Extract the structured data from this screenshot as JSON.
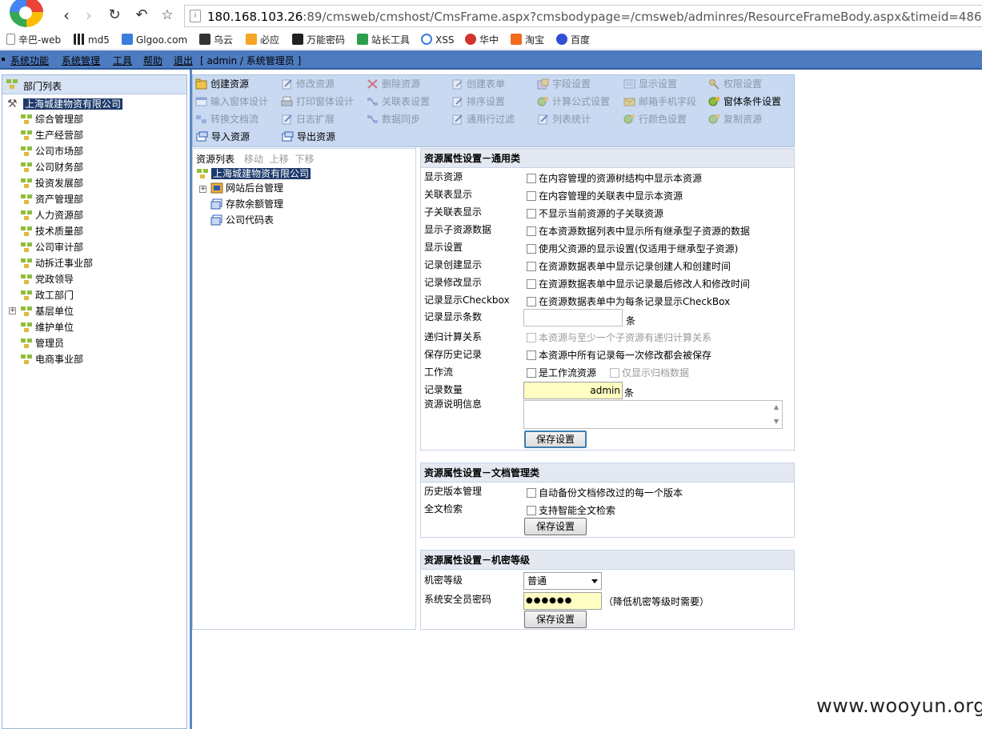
{
  "browser": {
    "url_host": "180.168.103.26",
    "url_path": ":89/cmsweb/cmshost/CmsFrame.aspx?cmsbodypage=/cmsweb/adminres/ResourceFrameBody.aspx&timeid=486686",
    "bookmarks": [
      "辛巴-web",
      "md5",
      "Glgoo.com",
      "乌云",
      "必应",
      "万能密码",
      "站长工具",
      "XSS",
      "华中",
      "淘宝",
      "百度"
    ]
  },
  "menubar": {
    "items": [
      "系统功能",
      "系统管理",
      "工具",
      "帮助",
      "退出"
    ],
    "user": "[ admin / 系统管理员 ]"
  },
  "dept_tree": {
    "header": "部门列表",
    "root": "上海城建物资有限公司",
    "departments": [
      "综合管理部",
      "生产经营部",
      "公司市场部",
      "公司财务部",
      "投资发展部",
      "资产管理部",
      "人力资源部",
      "技术质量部",
      "公司审计部",
      "动拆迁事业部",
      "党政领导",
      "政工部门",
      "基层单位",
      "维护单位",
      "管理员",
      "电商事业部"
    ]
  },
  "toolbar": {
    "row1": [
      {
        "label": "创建资源",
        "enabled": true,
        "icon": "folder-open-icon"
      },
      {
        "label": "修改资源",
        "enabled": false,
        "icon": "edit-icon"
      },
      {
        "label": "删除资源",
        "enabled": false,
        "icon": "delete-icon"
      },
      {
        "label": "创建表单",
        "enabled": false,
        "icon": "form-icon"
      },
      {
        "label": "字段设置",
        "enabled": false,
        "icon": "field-icon"
      },
      {
        "label": "显示设置",
        "enabled": false,
        "icon": "display-icon"
      },
      {
        "label": "权限设置",
        "enabled": false,
        "icon": "key-icon"
      }
    ],
    "row2": [
      {
        "label": "输入窗体设计",
        "enabled": false,
        "icon": "window-icon"
      },
      {
        "label": "打印窗体设计",
        "enabled": false,
        "icon": "printer-icon"
      },
      {
        "label": "关联表设置",
        "enabled": false,
        "icon": "relation-icon"
      },
      {
        "label": "排序设置",
        "enabled": false,
        "icon": "sort-icon"
      },
      {
        "label": "计算公式设置",
        "enabled": false,
        "icon": "formula-icon"
      },
      {
        "label": "邮箱手机字段",
        "enabled": false,
        "icon": "mail-icon"
      },
      {
        "label": "窗体条件设置",
        "enabled": true,
        "icon": "condition-icon"
      }
    ],
    "row3": [
      {
        "label": "转换文档流",
        "enabled": false,
        "icon": "convert-icon"
      },
      {
        "label": "日志扩展",
        "enabled": false,
        "icon": "log-icon"
      },
      {
        "label": "数据同步",
        "enabled": false,
        "icon": "sync-icon"
      },
      {
        "label": "通用行过滤",
        "enabled": false,
        "icon": "filter-icon"
      },
      {
        "label": "列表统计",
        "enabled": false,
        "icon": "stats-icon"
      },
      {
        "label": "行颜色设置",
        "enabled": false,
        "icon": "color-icon"
      },
      {
        "label": "复制资源",
        "enabled": false,
        "icon": "copy-icon"
      }
    ],
    "row4": [
      {
        "label": "导入资源",
        "enabled": true,
        "icon": "import-icon"
      },
      {
        "label": "导出资源",
        "enabled": true,
        "icon": "export-icon"
      }
    ]
  },
  "resource_list": {
    "title": "资源列表",
    "actions": [
      "移动",
      "上移",
      "下移"
    ],
    "root": "上海城建物资有限公司",
    "children": [
      "网站后台管理",
      "存款余额管理",
      "公司代码表"
    ]
  },
  "section_general": {
    "title": "资源属性设置－通用类",
    "rows": [
      {
        "label": "显示资源",
        "option": "在内容管理的资源树结构中显示本资源"
      },
      {
        "label": "关联表显示",
        "option": "在内容管理的关联表中显示本资源"
      },
      {
        "label": "子关联表显示",
        "option": "不显示当前资源的子关联资源"
      },
      {
        "label": "显示子资源数据",
        "option": "在本资源数据列表中显示所有继承型子资源的数据"
      },
      {
        "label": "显示设置",
        "option": "使用父资源的显示设置(仅适用于继承型子资源)"
      },
      {
        "label": "记录创建显示",
        "option": "在资源数据表单中显示记录创建人和创建时间"
      },
      {
        "label": "记录修改显示",
        "option": "在资源数据表单中显示记录最后修改人和修改时间"
      },
      {
        "label": "记录显示Checkbox",
        "option": "在资源数据表单中为每条记录显示CheckBox"
      }
    ],
    "record_count_label": "记录显示条数",
    "unit": "条",
    "recursive_label": "递归计算关系",
    "recursive_option": "本资源与至少一个子资源有递归计算关系",
    "history_label": "保存历史记录",
    "history_option": "本资源中所有记录每一次修改都会被保存",
    "workflow_label": "工作流",
    "workflow_option": "是工作流资源",
    "archive_option": "仅显示归档数据",
    "quantity_label": "记录数量",
    "quantity_value": "admin",
    "desc_label": "资源说明信息",
    "save": "保存设置"
  },
  "section_document": {
    "title": "资源属性设置－文档管理类",
    "rows": [
      {
        "label": "历史版本管理",
        "option": "自动备份文档修改过的每一个版本"
      },
      {
        "label": "全文检索",
        "option": "支持智能全文检索"
      }
    ],
    "save": "保存设置"
  },
  "section_security": {
    "title": "资源属性设置－机密等级",
    "level_label": "机密等级",
    "level_value": "普通",
    "password_label": "系统安全员密码",
    "password_value": "●●●●●●",
    "password_hint": "（降低机密等级时需要）",
    "save": "保存设置"
  },
  "watermark": "www.wooyun.org"
}
